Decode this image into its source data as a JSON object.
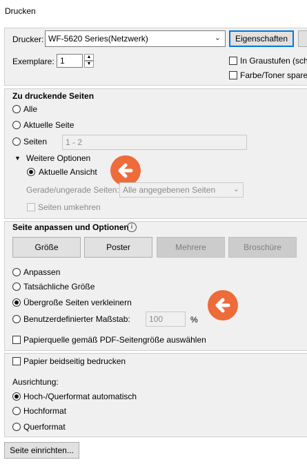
{
  "window": {
    "title": "Drucken"
  },
  "printer": {
    "label": "Drucker:",
    "selected": "WF-5620 Series(Netzwerk)",
    "properties_button": "Eigenschaften",
    "copies_label": "Exemplare:",
    "copies_value": "1",
    "grayscale_label": "In Graustufen (schw",
    "save_toner_label": "Farbe/Toner sparen"
  },
  "pages": {
    "title": "Zu druckende Seiten",
    "all": "Alle",
    "current_page": "Aktuelle Seite",
    "pages": "Seiten",
    "pages_value": "1 - 2",
    "more_options": "Weitere Optionen",
    "current_view": "Aktuelle Ansicht",
    "odd_even_label": "Gerade/ungerade Seiten:",
    "odd_even_value": "Alle angegebenen Seiten",
    "reverse": "Seiten umkehren"
  },
  "sizing": {
    "title": "Seite anpassen und Optionen",
    "tabs": [
      "Größe",
      "Poster",
      "Mehrere",
      "Broschüre"
    ],
    "fit": "Anpassen",
    "actual_size": "Tatsächliche Größe",
    "shrink_oversized": "Übergroße Seiten verkleinern",
    "custom_scale": "Benutzerdefinierter Maßstab:",
    "custom_scale_value": "100",
    "percent": "%",
    "paper_source": "Papierquelle gemäß PDF-Seitengröße auswählen"
  },
  "duplex": {
    "label": "Papier beidseitig bedrucken"
  },
  "orientation": {
    "title": "Ausrichtung:",
    "auto": "Hoch-/Querformat automatisch",
    "portrait": "Hochformat",
    "landscape": "Querformat"
  },
  "footer": {
    "page_setup": "Seite einrichten..."
  },
  "colors": {
    "accent_arrow": "#ee6b3a"
  }
}
